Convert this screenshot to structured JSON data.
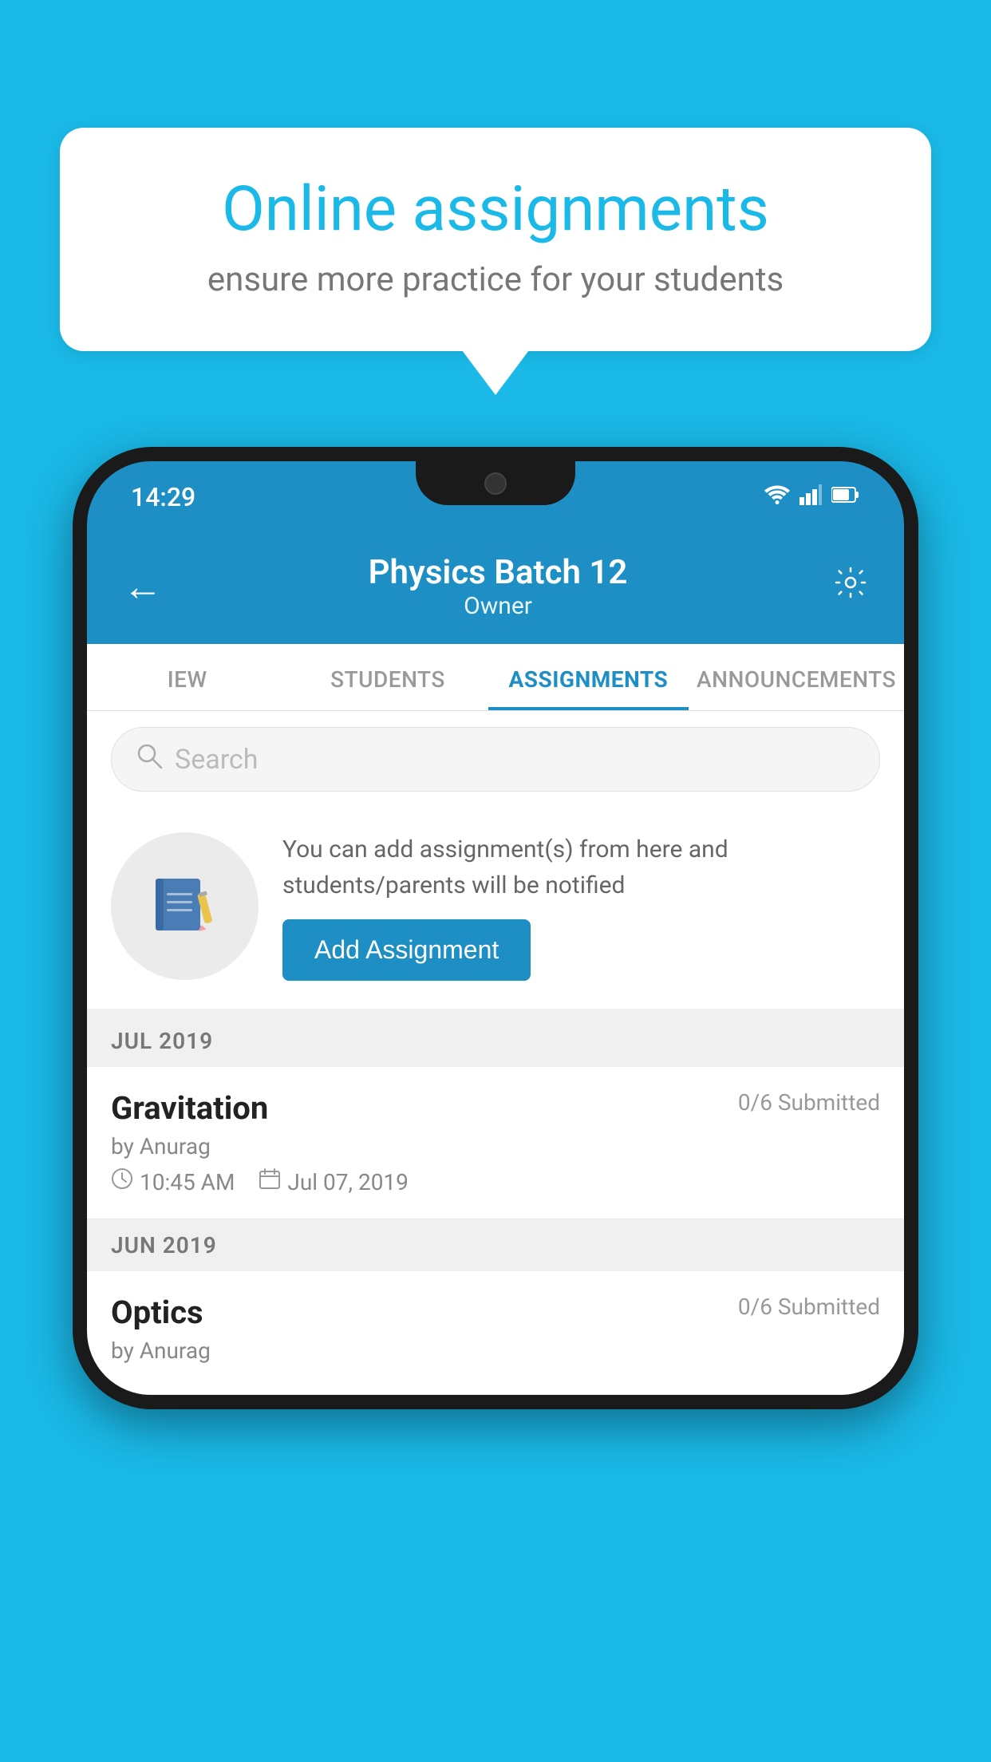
{
  "background": {
    "color": "#1ab9e8"
  },
  "speech_bubble": {
    "title": "Online assignments",
    "subtitle": "ensure more practice for your students"
  },
  "phone": {
    "status_bar": {
      "time": "14:29"
    },
    "header": {
      "title": "Physics Batch 12",
      "subtitle": "Owner",
      "back_label": "←",
      "settings_label": "⚙"
    },
    "tabs": [
      {
        "label": "IEW",
        "active": false
      },
      {
        "label": "STUDENTS",
        "active": false
      },
      {
        "label": "ASSIGNMENTS",
        "active": true
      },
      {
        "label": "ANNOUNCEMENTS",
        "active": false
      }
    ],
    "search": {
      "placeholder": "Search"
    },
    "promo": {
      "description": "You can add assignment(s) from here and students/parents will be notified",
      "button_label": "Add Assignment"
    },
    "sections": [
      {
        "label": "JUL 2019",
        "assignments": [
          {
            "title": "Gravitation",
            "status": "0/6 Submitted",
            "by": "by Anurag",
            "time": "10:45 AM",
            "date": "Jul 07, 2019"
          }
        ]
      },
      {
        "label": "JUN 2019",
        "assignments": [
          {
            "title": "Optics",
            "status": "0/6 Submitted",
            "by": "by Anurag",
            "time": "",
            "date": ""
          }
        ]
      }
    ]
  }
}
